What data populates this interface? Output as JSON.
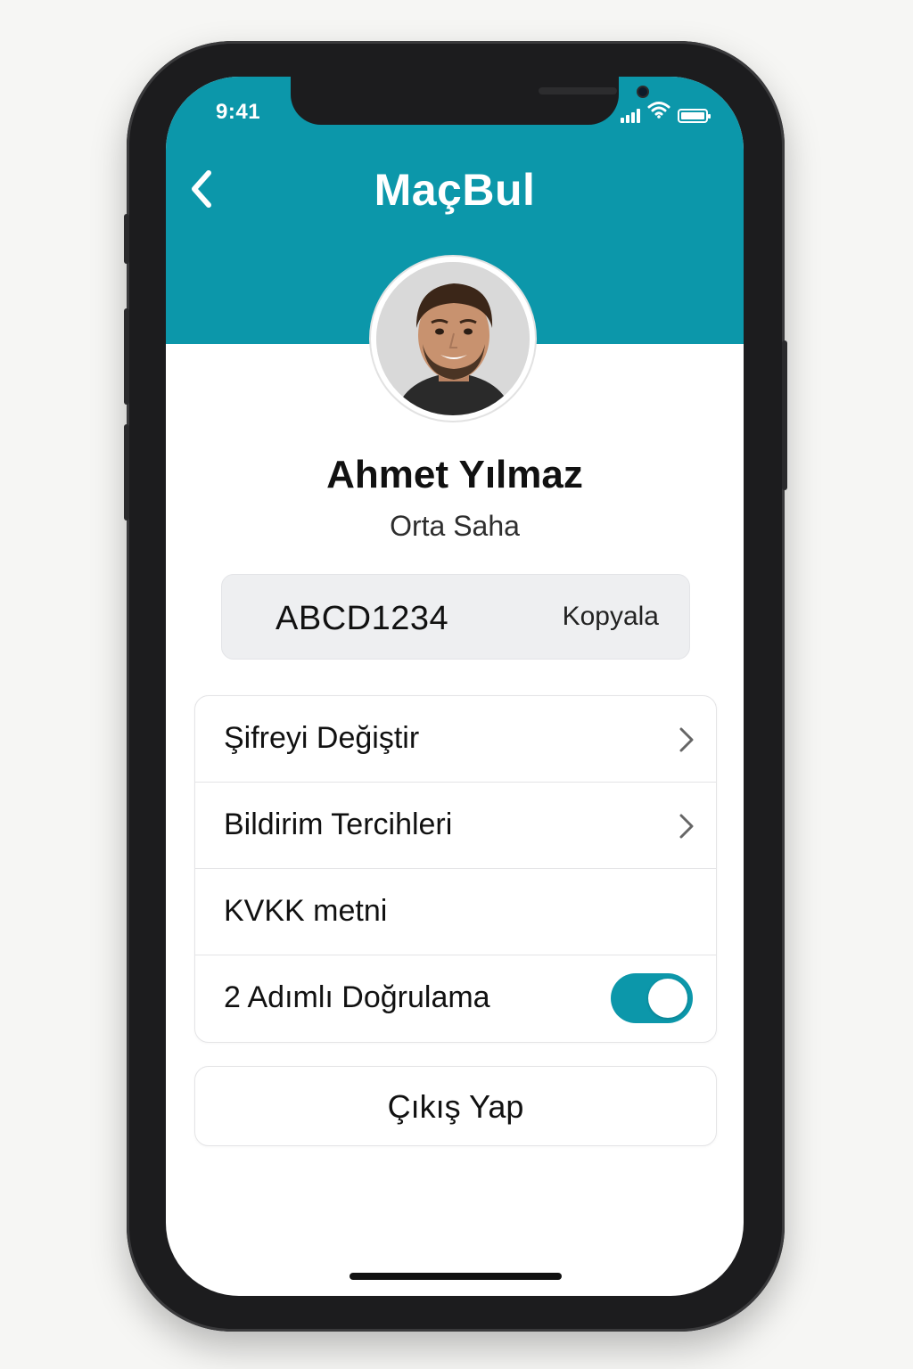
{
  "status_bar": {
    "time": "9:41",
    "icons": [
      "signal-icon",
      "wifi-icon",
      "battery-icon"
    ]
  },
  "header": {
    "title": "MaçBul",
    "back_icon": "chevron-left-icon",
    "background_color": "#0c97aa"
  },
  "profile": {
    "avatar": "avatar-photo",
    "name": "Ahmet Yılmaz",
    "position": "Orta Saha"
  },
  "code": {
    "value": "ABCD1234",
    "copy_label": "Kopyala"
  },
  "settings": {
    "items": [
      {
        "label": "Şifreyi Değiştir",
        "trailing": "chevron-right-icon"
      },
      {
        "label": "Bildirim Tercihleri",
        "trailing": "chevron-right-icon"
      },
      {
        "label": "KVKK metni",
        "trailing": ""
      },
      {
        "label": "2 Adımlı Doğrulama",
        "trailing": "toggle",
        "toggle_on": true
      }
    ]
  },
  "logout": {
    "label": "Çıkış Yap"
  },
  "colors": {
    "accent": "#0c97aa",
    "text_primary": "#111111",
    "code_box_bg": "#eeeff1"
  }
}
